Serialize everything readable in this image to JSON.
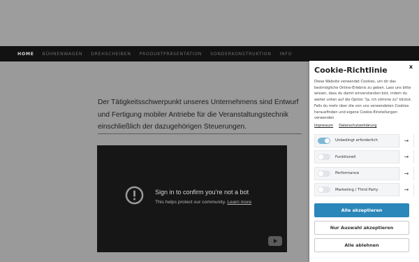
{
  "nav": {
    "items": [
      {
        "label": "HOME",
        "active": true
      },
      {
        "label": "BÜHNENWAGEN",
        "active": false
      },
      {
        "label": "DREHSCHEIBEN",
        "active": false
      },
      {
        "label": "PRODUKTPRÄSENTATION",
        "active": false
      },
      {
        "label": "SONDERKONSTRUKTION",
        "active": false
      },
      {
        "label": "INFO",
        "active": false
      }
    ]
  },
  "main": {
    "intro_text": "Der Tätigkeitsschwerpunkt unseres Unternehmens sind Entwurf und Fertigung mobiler Antriebe für die Veranstaltungstechnik einschließlich der dazugehörigen Steuerungen."
  },
  "video": {
    "title": "Sign in to confirm you’re not a bot",
    "subtitle": "This helps protect our community.",
    "link": "Learn more",
    "icon": "alert-circle-icon",
    "brand_icon": "youtube-icon"
  },
  "cookie": {
    "close": "x",
    "title": "Cookie-Richtlinie",
    "text": "Diese Website verwendet Cookies, um dir das bestmögliche Online-Erlebnis zu geben. Lass uns bitte wissen, dass du damit einverstanden bist, indem du weiter unten auf die Option \"Ja, ich stimme zu\" klickst. Falls du mehr über die von uns verwendeten Cookies herausfinden und eigene Cookie-Einstellungen verwenden",
    "links": [
      "Impressum",
      "Datenschutzerklärung"
    ],
    "categories": [
      {
        "label": "Unbedingt erforderlich",
        "enabled": true
      },
      {
        "label": "Funktionell",
        "enabled": false
      },
      {
        "label": "Performance",
        "enabled": false
      },
      {
        "label": "Marketing / Third Party",
        "enabled": false
      }
    ],
    "buttons": {
      "accept_all": "Alle akzeptieren",
      "accept_selection": "Nur Auswahl akzeptieren",
      "reject_all": "Alle ablehnen"
    },
    "accent": "#2b86b9"
  }
}
